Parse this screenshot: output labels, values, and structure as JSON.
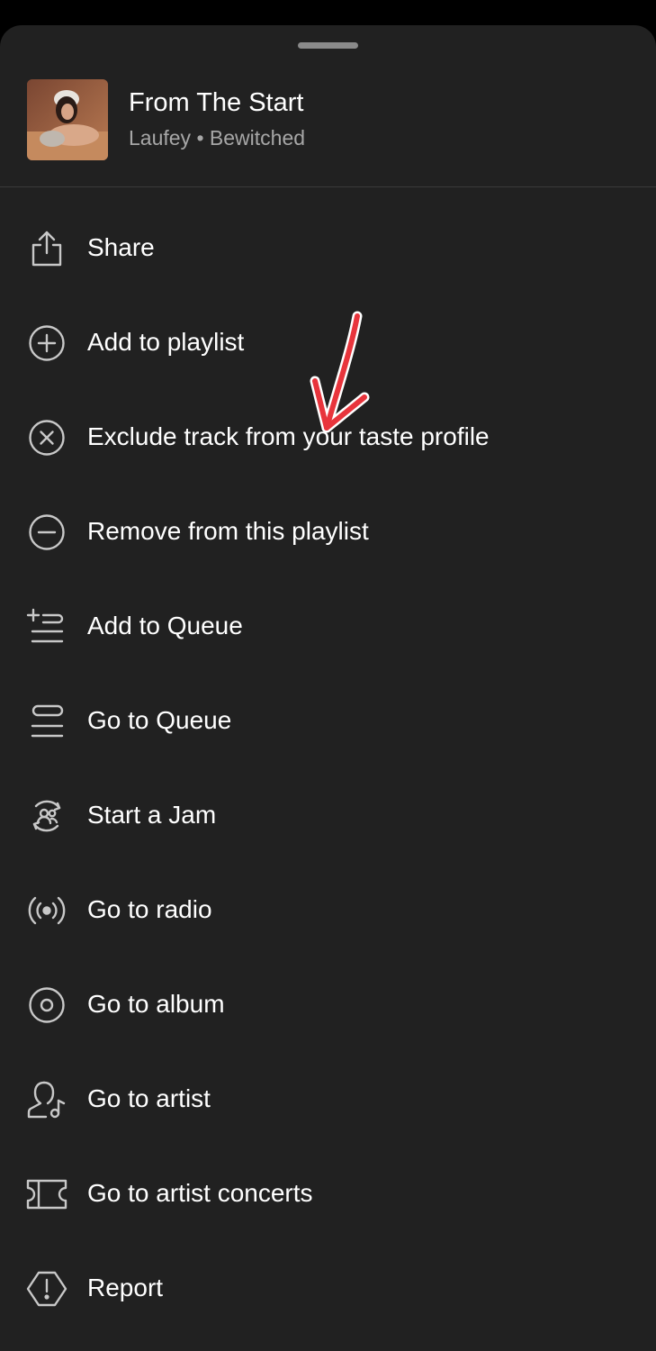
{
  "track": {
    "title": "From The Start",
    "artist": "Laufey",
    "separator": "•",
    "album": "Bewitched"
  },
  "menu": {
    "items": [
      {
        "label": "Share",
        "icon": "share-icon"
      },
      {
        "label": "Add to playlist",
        "icon": "plus-circle-icon"
      },
      {
        "label": "Exclude track from your taste profile",
        "icon": "x-circle-icon"
      },
      {
        "label": "Remove from this playlist",
        "icon": "minus-circle-icon"
      },
      {
        "label": "Add to Queue",
        "icon": "add-queue-icon"
      },
      {
        "label": "Go to Queue",
        "icon": "queue-icon"
      },
      {
        "label": "Start a Jam",
        "icon": "jam-icon"
      },
      {
        "label": "Go to radio",
        "icon": "radio-icon"
      },
      {
        "label": "Go to album",
        "icon": "album-icon"
      },
      {
        "label": "Go to artist",
        "icon": "artist-icon"
      },
      {
        "label": "Go to artist concerts",
        "icon": "ticket-icon"
      },
      {
        "label": "Report",
        "icon": "report-icon"
      }
    ]
  },
  "colors": {
    "sheet_background": "#212121",
    "text_primary": "#ffffff",
    "text_secondary": "#a7a7a7",
    "annotation_arrow": "#e8343c"
  }
}
